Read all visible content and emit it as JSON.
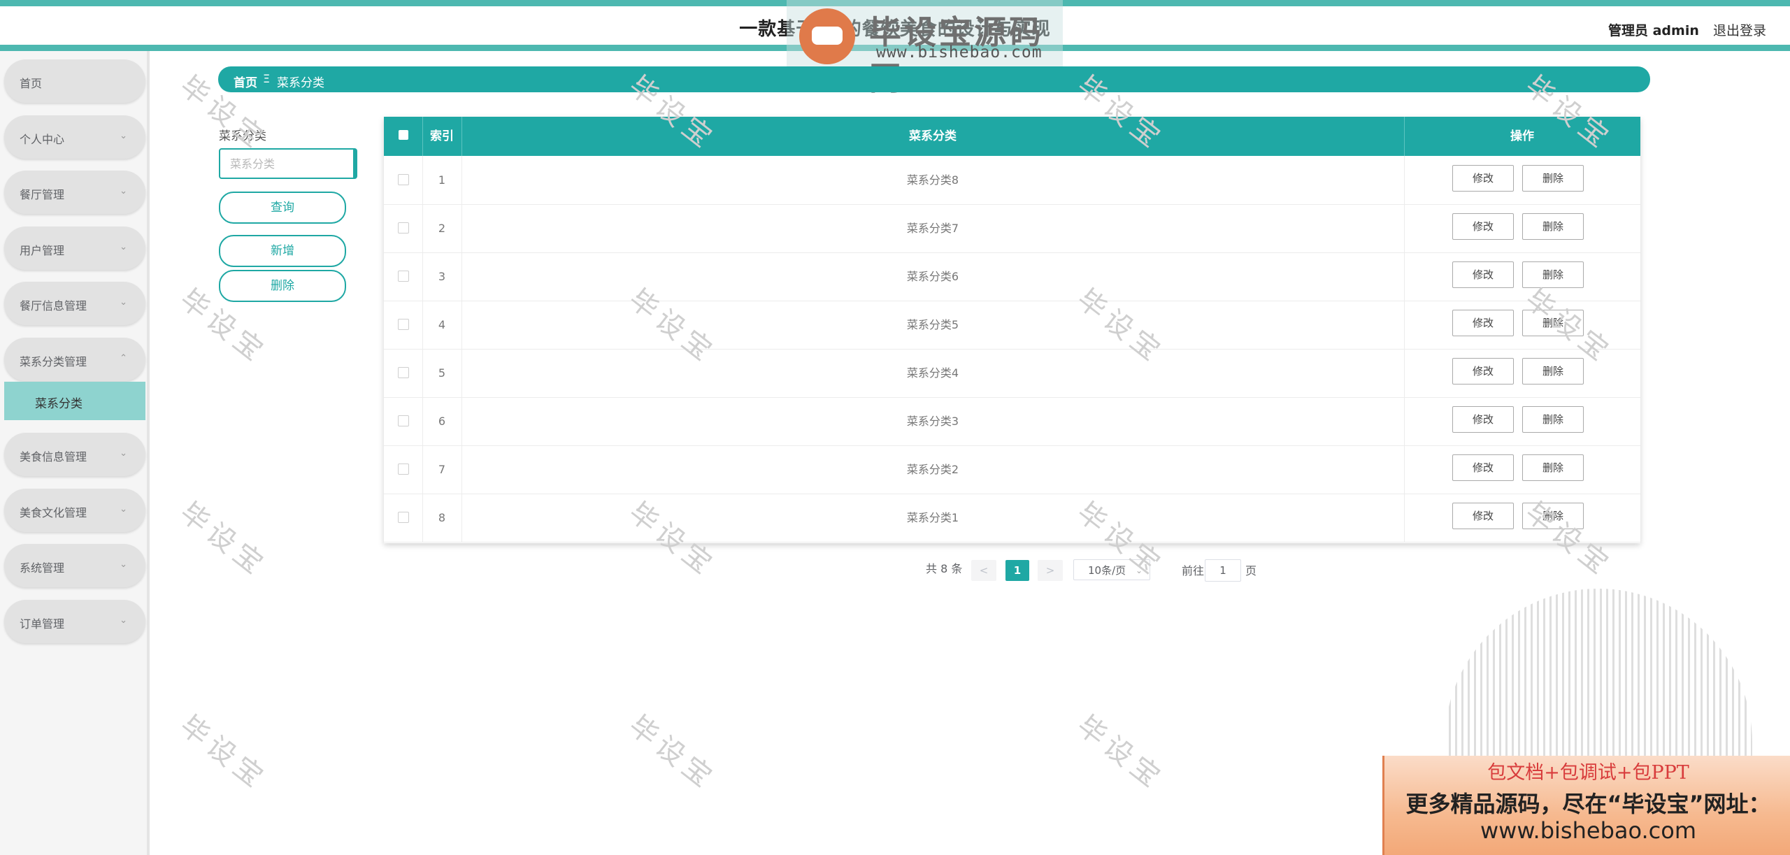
{
  "header": {
    "title": "一款基于BS的餐饮美食的设计与实现",
    "user_label": "管理员 admin",
    "logout_label": "退出登录",
    "logo_text": "毕设宝源码网",
    "logo_url": "www.bishebao.com"
  },
  "sidebar": {
    "items": [
      {
        "label": "首页"
      },
      {
        "label": "个人中心"
      },
      {
        "label": "餐厅管理"
      },
      {
        "label": "用户管理"
      },
      {
        "label": "餐厅信息管理"
      },
      {
        "label": "菜系分类管理"
      },
      {
        "label": "美食信息管理"
      },
      {
        "label": "美食文化管理"
      },
      {
        "label": "系统管理"
      },
      {
        "label": "订单管理"
      }
    ],
    "active_sub": "菜系分类",
    "arrow_down": "⌄",
    "arrow_up": "⌃"
  },
  "breadcrumb": {
    "home": "首页",
    "separator": "Ξ",
    "current": "菜系分类"
  },
  "search": {
    "label": "菜系分类",
    "placeholder": "菜系分类",
    "query_label": "查询",
    "add_label": "新增",
    "delete_label": "删除"
  },
  "table": {
    "columns": [
      "索引",
      "菜系分类",
      "操作"
    ],
    "rows": [
      {
        "index": "1",
        "name": "菜系分类8"
      },
      {
        "index": "2",
        "name": "菜系分类7"
      },
      {
        "index": "3",
        "name": "菜系分类6"
      },
      {
        "index": "4",
        "name": "菜系分类5"
      },
      {
        "index": "5",
        "name": "菜系分类4"
      },
      {
        "index": "6",
        "name": "菜系分类3"
      },
      {
        "index": "7",
        "name": "菜系分类2"
      },
      {
        "index": "8",
        "name": "菜系分类1"
      }
    ],
    "edit_label": "修改",
    "delete_label": "删除"
  },
  "pagination": {
    "total": "共 8 条",
    "prev": "<",
    "current": "1",
    "next": ">",
    "page_size": "10条/页",
    "goto_prefix": "前往",
    "goto_value": "1",
    "goto_suffix": "页"
  },
  "watermark": "毕设宝",
  "ad": {
    "line1": "包文档+包调试+包PPT",
    "line2": "更多精品源码，尽在“毕设宝”网址：",
    "line3": "www.bishebao.com"
  },
  "colors": {
    "accent": "#1fa8a4",
    "top_bar": "#4db8b0",
    "submenu_active": "#8ed3cf"
  }
}
